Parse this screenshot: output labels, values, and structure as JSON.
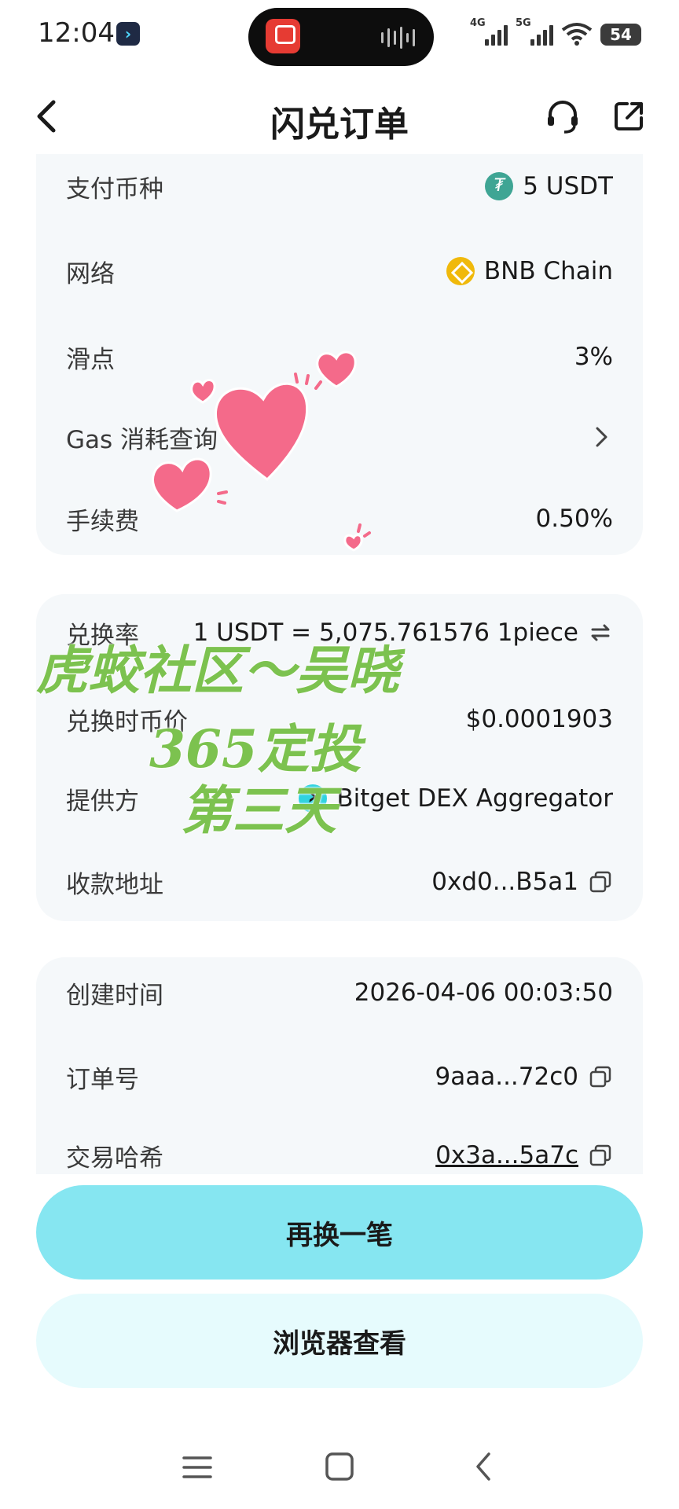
{
  "status_bar": {
    "time": "12:04",
    "app_badge": "›",
    "network1": "4G",
    "network2": "5G",
    "battery": "54"
  },
  "header": {
    "title": "闪兑订单"
  },
  "card1": {
    "rows": [
      {
        "label": "支付币种",
        "value": "5 USDT",
        "icon": "usdt-coin-icon"
      },
      {
        "label": "网络",
        "value": "BNB Chain",
        "icon": "bnb-coin-icon"
      },
      {
        "label": "滑点",
        "value": "3%"
      },
      {
        "label": "Gas 消耗查询",
        "icon": "chevron-right-icon"
      },
      {
        "label": "手续费",
        "value": "0.50%"
      }
    ]
  },
  "card2": {
    "rows": [
      {
        "label": "兑换率",
        "value": "1 USDT = 5,075.761576 1piece",
        "icon": "swap-icon"
      },
      {
        "label": "兑换时币价",
        "value": "$0.0001903"
      },
      {
        "label": "提供方",
        "value": "Bitget DEX Aggregator",
        "icon": "bitget-icon"
      },
      {
        "label": "收款地址",
        "value": "0xd0...B5a1",
        "icon": "copy-icon"
      }
    ]
  },
  "card3": {
    "rows": [
      {
        "label": "创建时间",
        "value": "2026-04-06 00:03:50"
      },
      {
        "label": "订单号",
        "value": "9aaa...72c0",
        "icon": "copy-icon"
      },
      {
        "label": "交易哈希",
        "value": "0x3a...5a7c",
        "icon": "copy-icon"
      }
    ]
  },
  "buttons": {
    "primary": "再换一笔",
    "secondary": "浏览器查看"
  },
  "watermark": {
    "line1": "虎蛟社区～吴晓",
    "line2": "365定投",
    "line3": "第三天"
  },
  "colors": {
    "primary_button": "#86e6f1",
    "secondary_button": "#e6fbfd",
    "card_background": "#f5f8fa",
    "watermark": "#7cc24f",
    "heart": "#f46a8a"
  }
}
